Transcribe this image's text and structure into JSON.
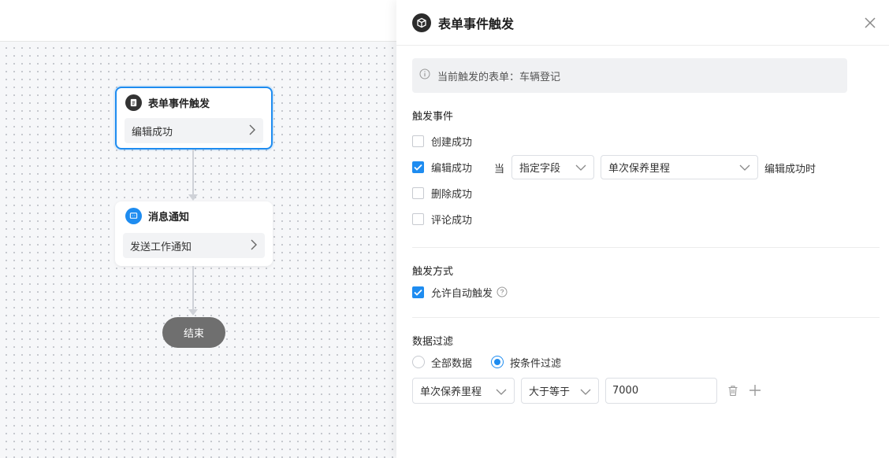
{
  "flow": {
    "trigger_node": {
      "title": "表单事件触发",
      "body": "编辑成功"
    },
    "notify_node": {
      "title": "消息通知",
      "body": "发送工作通知"
    },
    "end_node": {
      "label": "结束"
    }
  },
  "panel": {
    "title": "表单事件触发",
    "info_text": "当前触发的表单：车辆登记",
    "trigger_events": {
      "title": "触发事件",
      "items": [
        {
          "label": "创建成功",
          "checked": false
        },
        {
          "label": "编辑成功",
          "checked": true
        },
        {
          "label": "删除成功",
          "checked": false
        },
        {
          "label": "评论成功",
          "checked": false
        }
      ],
      "condition": {
        "when_label": "当",
        "field_mode": "指定字段",
        "field": "单次保养里程",
        "suffix": "编辑成功时"
      }
    },
    "trigger_mode": {
      "title": "触发方式",
      "auto_label": "允许自动触发",
      "auto_checked": true
    },
    "data_filter": {
      "title": "数据过滤",
      "options": [
        {
          "label": "全部数据",
          "selected": false
        },
        {
          "label": "按条件过滤",
          "selected": true
        }
      ],
      "rule": {
        "field": "单次保养里程",
        "operator": "大于等于",
        "value": "7000"
      }
    }
  },
  "colors": {
    "accent": "#1e8cf0",
    "end_node": "#6f6f6f"
  }
}
